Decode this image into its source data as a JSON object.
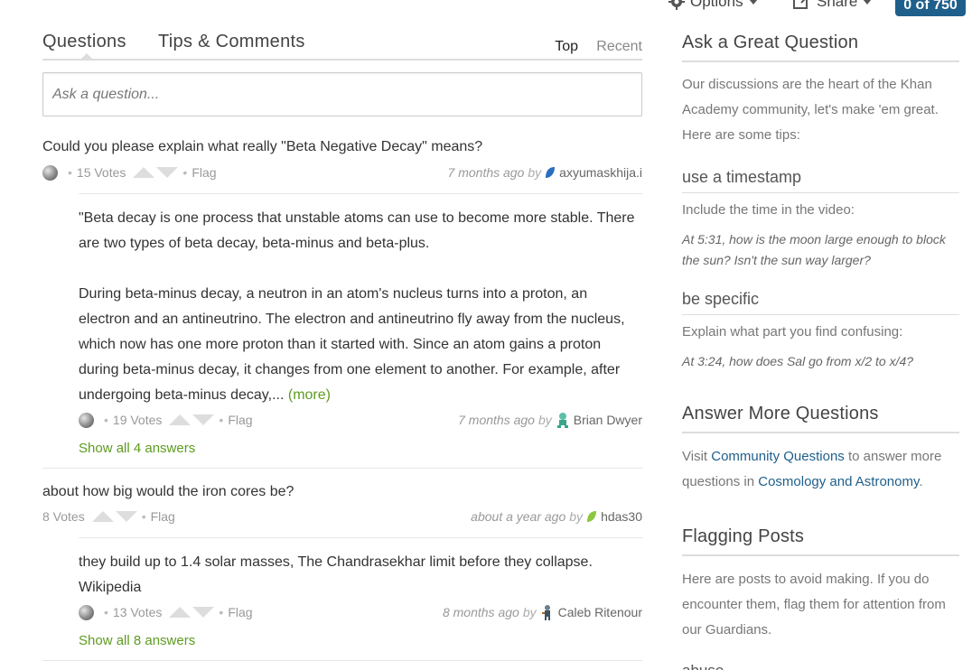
{
  "toolbar": {
    "options_label": "Options",
    "share_label": "Share",
    "points_label": "0 of 750"
  },
  "tabs": {
    "questions": "Questions",
    "tips": "Tips & Comments",
    "sort_top": "Top",
    "sort_recent": "Recent"
  },
  "ask": {
    "placeholder": "Ask a question..."
  },
  "threads": [
    {
      "question": "Could you please explain what really \"Beta Negative Decay\" means?",
      "votes": "15 Votes",
      "flag": "Flag",
      "when": "7 months ago",
      "by": "by",
      "author": "axyumaskhija.i",
      "answer_p1": "\"Beta decay is one process that unstable atoms can use to become more stable. There are two types of beta decay, beta-minus and beta-plus.",
      "answer_p2": "During beta-minus decay, a neutron in an atom's nucleus turns into a proton, an electron and an antineutrino. The electron and antineutrino fly away from the nucleus, which now has one more proton than it started with. Since an atom gains a proton during beta-minus decay, it changes from one element to another. For example, after undergoing beta-minus decay,...",
      "more": "(more)",
      "answer_votes": "19 Votes",
      "answer_flag": "Flag",
      "answer_when": "7 months ago",
      "answer_by": "by",
      "answer_author": "Brian Dwyer",
      "show_all": "Show all 4 answers"
    },
    {
      "question": "about how big would the iron cores be?",
      "votes": "8 Votes",
      "flag": "Flag",
      "when": "about a year ago",
      "by": "by",
      "author": "hdas30",
      "answer_p1": "they build up to 1.4 solar masses, The Chandrasekhar limit before they collapse. Wikipedia",
      "answer_votes": "13 Votes",
      "answer_flag": "Flag",
      "answer_when": "8 months ago",
      "answer_by": "by",
      "answer_author": "Caleb Ritenour",
      "show_all": "Show all 8 answers"
    }
  ],
  "sidebar": {
    "ask_heading": "Ask a Great Question",
    "ask_intro": "Our discussions are the heart of the Khan Academy community, let's make 'em great. Here are some tips:",
    "tip1_heading": "use a timestamp",
    "tip1_text": "Include the time in the video:",
    "tip1_example": "At 5:31, how is the moon large enough to block the sun? Isn't the sun way larger?",
    "tip2_heading": "be specific",
    "tip2_text": "Explain what part you find confusing:",
    "tip2_example": "At 3:24, how does Sal go from x/2 to x/4?",
    "answer_heading": "Answer More Questions",
    "answer_pre": "Visit ",
    "answer_link1": "Community Questions",
    "answer_mid": " to answer more questions in ",
    "answer_link2": "Cosmology and Astronomy",
    "answer_post": ".",
    "flag_heading": "Flagging Posts",
    "flag_text": "Here are posts to avoid making. If you do encounter them, flag them for attention from our Guardians.",
    "cut_text": "abuse"
  },
  "colors": {
    "accent_green": "#5e9b1f",
    "link_blue": "#1f5f8b",
    "points_badge": "#1f5f8b"
  }
}
